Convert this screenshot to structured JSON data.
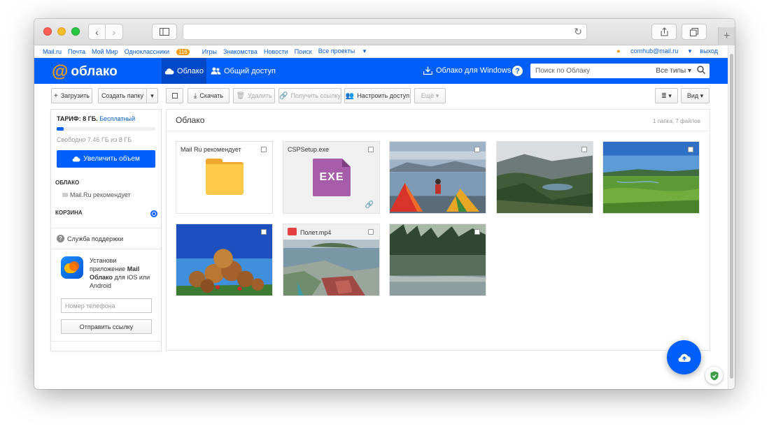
{
  "browser": {
    "url": "",
    "back_icon": "chevron-left",
    "forward_icon": "chevron-right"
  },
  "topnav": {
    "links": [
      "Mail.ru",
      "Почта",
      "Мой Мир",
      "Одноклассники",
      "Игры",
      "Знакомства",
      "Новости",
      "Поиск",
      "Все проекты"
    ],
    "ok_badge": "116",
    "user_email": "comhub@mail.ru",
    "logout": "выход"
  },
  "header": {
    "logo_at": "@",
    "logo_text": "облако",
    "tab_cloud": "Облако",
    "tab_share": "Общий доступ",
    "windows_link": "Облако для Windows",
    "help": "?",
    "search_placeholder": "Поиск по Облаку",
    "search_types": "Все типы"
  },
  "toolbar": {
    "upload": "Загрузить",
    "create_folder": "Создать папку",
    "download": "Скачать",
    "delete": "Удалить",
    "get_link": "Получить ссылку",
    "share": "Настроить доступ",
    "more": "Ещё",
    "view": "Вид"
  },
  "sidebar": {
    "tariff_label": "ТАРИФ: 8 ГБ.",
    "tariff_plan": "Бесплатный",
    "usage_fraction": 0.07,
    "free_space": "Свободно 7.46 ГБ из 8 ГБ",
    "increase": "Увеличить объем",
    "cloud_head": "ОБЛАКО",
    "cloud_item": "Mail.Ru рекомендует",
    "trash_head": "КОРЗИНА",
    "support": "Служба поддержки",
    "promo_line1": "Установи",
    "promo_line2": "приложение",
    "promo_bold1": "Mail",
    "promo_bold2": "Облако",
    "promo_line3": "для iOS или",
    "promo_line4": "Android",
    "phone_placeholder": "Номер телефона",
    "send": "Отправить ссылку"
  },
  "main": {
    "title": "Облако",
    "count": "1 папка, 7 файлов",
    "files": [
      {
        "name": "Mail Ru рекомендует",
        "type": "folder"
      },
      {
        "name": "CSPSetup.exe",
        "type": "exe",
        "ext_label": "EXE"
      },
      {
        "name": "",
        "type": "photo"
      },
      {
        "name": "",
        "type": "photo"
      },
      {
        "name": "",
        "type": "photo"
      },
      {
        "name": "",
        "type": "photo"
      },
      {
        "name": "Полет.mp4",
        "type": "video"
      },
      {
        "name": "",
        "type": "photo"
      }
    ]
  },
  "colors": {
    "brand_blue": "#005ff9",
    "logo_orange": "#ff9e00"
  }
}
